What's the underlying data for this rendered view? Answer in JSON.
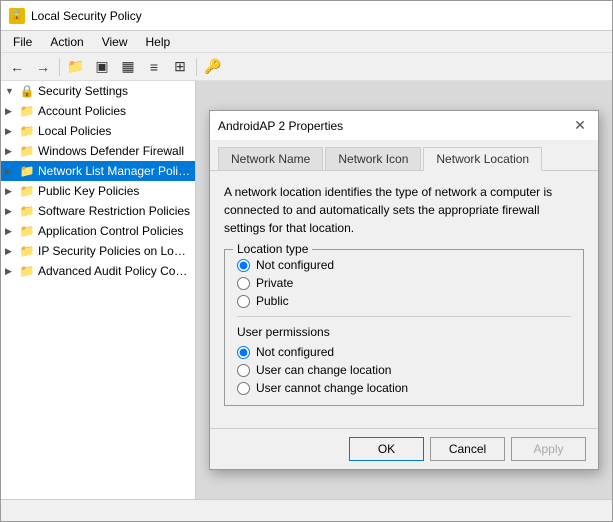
{
  "titleBar": {
    "title": "Local Security Policy",
    "iconSymbol": "🔒"
  },
  "menuBar": {
    "items": [
      "File",
      "Action",
      "View",
      "Help"
    ]
  },
  "toolbar": {
    "buttons": [
      "←",
      "→",
      "📁",
      "◻",
      "◻",
      "◻",
      "◻",
      "🔑"
    ]
  },
  "sidebar": {
    "items": [
      {
        "id": "security-settings",
        "label": "Security Settings",
        "indent": 0,
        "expanded": true,
        "isRoot": true
      },
      {
        "id": "account-policies",
        "label": "Account Policies",
        "indent": 1,
        "hasChildren": true
      },
      {
        "id": "local-policies",
        "label": "Local Policies",
        "indent": 1,
        "hasChildren": true
      },
      {
        "id": "windows-defender",
        "label": "Windows Defender Firewall",
        "indent": 1,
        "hasChildren": true
      },
      {
        "id": "network-list",
        "label": "Network List Manager Polic...",
        "indent": 1,
        "selected": true,
        "hasChildren": true
      },
      {
        "id": "public-key",
        "label": "Public Key Policies",
        "indent": 1,
        "hasChildren": true
      },
      {
        "id": "software-restriction",
        "label": "Software Restriction Policies",
        "indent": 1,
        "hasChildren": true
      },
      {
        "id": "application-control",
        "label": "Application Control Policies",
        "indent": 1,
        "hasChildren": true
      },
      {
        "id": "ip-security",
        "label": "IP Security Policies on Local...",
        "indent": 1,
        "hasChildren": true
      },
      {
        "id": "advanced-audit",
        "label": "Advanced Audit Policy Cont...",
        "indent": 1,
        "hasChildren": true
      }
    ]
  },
  "dialog": {
    "title": "AndroidAP  2 Properties",
    "tabs": [
      "Network Name",
      "Network Icon",
      "Network Location"
    ],
    "activeTab": "Network Location",
    "description": "A network location identifies the type of network a computer is connected to and automatically sets the appropriate firewall settings for that location.",
    "locationTypeLabel": "Location type",
    "locationOptions": [
      {
        "id": "loc-notconfigured",
        "label": "Not configured",
        "selected": true
      },
      {
        "id": "loc-private",
        "label": "Private",
        "selected": false
      },
      {
        "id": "loc-public",
        "label": "Public",
        "selected": false
      }
    ],
    "userPermissionsLabel": "User permissions",
    "permissionOptions": [
      {
        "id": "perm-notconfigured",
        "label": "Not configured",
        "selected": true
      },
      {
        "id": "perm-canchange",
        "label": "User can change location",
        "selected": false
      },
      {
        "id": "perm-cannotchange",
        "label": "User cannot change location",
        "selected": false
      }
    ],
    "buttons": {
      "ok": "OK",
      "cancel": "Cancel",
      "apply": "Apply"
    }
  }
}
